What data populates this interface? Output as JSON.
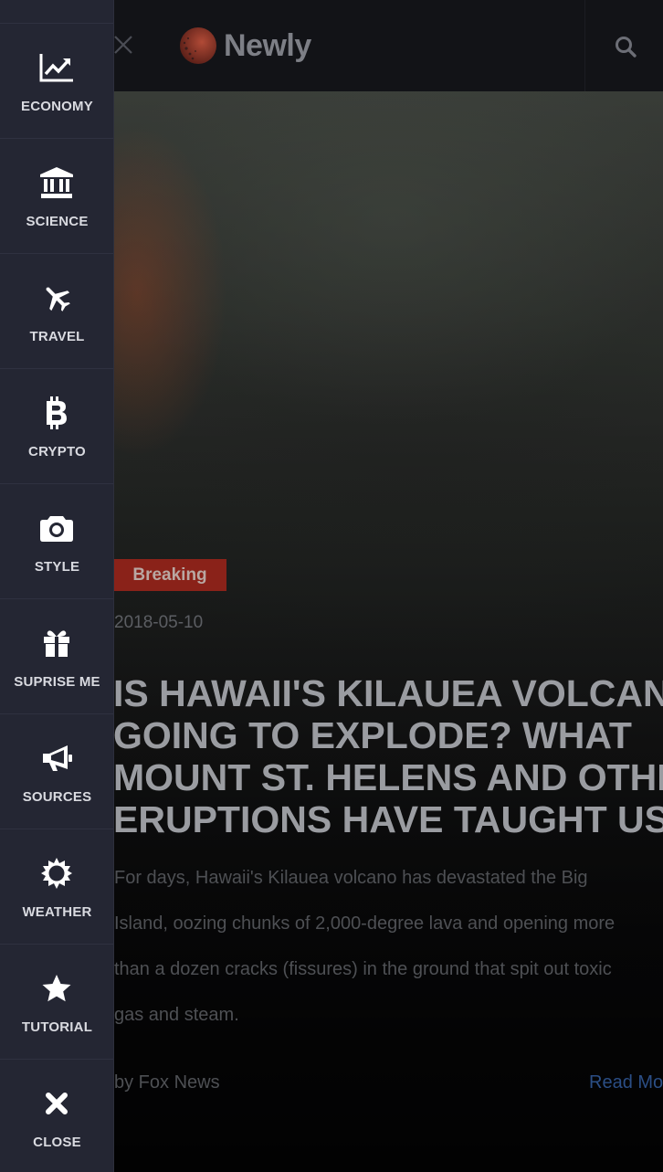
{
  "header": {
    "brand": "Newly"
  },
  "article": {
    "badge": "Breaking",
    "date": "2018-05-10",
    "title_lines": [
      "IS HAWAII'S KILAUEA VOLCANO",
      "GOING TO EXPLODE? WHAT",
      "MOUNT ST. HELENS AND OTHER",
      "ERUPTIONS HAVE TAUGHT US"
    ],
    "desc_lines": [
      "For days, Hawaii's Kilauea volcano has devastated the Big",
      "Island, oozing chunks of 2,000-degree lava and opening more",
      "than a dozen cracks (fissures) in the ground that spit out toxic",
      "gas and steam."
    ],
    "byline": "by Fox News",
    "read_more": "Read More"
  },
  "sidebar": {
    "items": [
      {
        "label": "ECONOMY",
        "icon": "chart-line-icon"
      },
      {
        "label": "SCIENCE",
        "icon": "museum-icon"
      },
      {
        "label": "TRAVEL",
        "icon": "plane-icon"
      },
      {
        "label": "CRYPTO",
        "icon": "bitcoin-icon"
      },
      {
        "label": "STYLE",
        "icon": "camera-icon"
      },
      {
        "label": "SUPRISE ME",
        "icon": "gift-icon"
      },
      {
        "label": "SOURCES",
        "icon": "megaphone-icon"
      },
      {
        "label": "WEATHER",
        "icon": "sun-icon"
      },
      {
        "label": "TUTORIAL",
        "icon": "star-icon"
      },
      {
        "label": "CLOSE",
        "icon": "close-icon"
      }
    ]
  },
  "colors": {
    "sidebar_bg": "#242633",
    "badge_bg": "#8a2219",
    "link": "#2b4e85",
    "logo_accent": "#8f3a2c"
  }
}
